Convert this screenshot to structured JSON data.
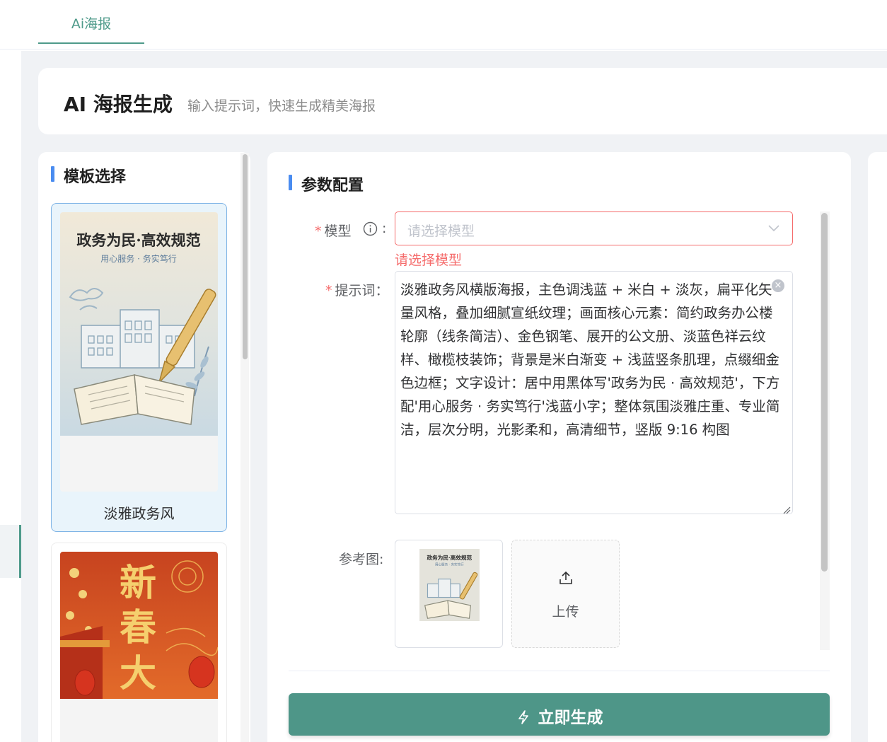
{
  "tabs": [
    {
      "label": "Ai海报"
    }
  ],
  "header": {
    "title": "AI 海报生成",
    "subtitle": "输入提示词，快速生成精美海报"
  },
  "templates": {
    "title": "模板选择",
    "items": [
      {
        "name": "淡雅政务风",
        "poster_title": "政务为民·高效规范",
        "poster_sub": "用心服务 · 务实笃行"
      },
      {
        "name": "",
        "poster_title": "新春大",
        "poster_sub": ""
      }
    ]
  },
  "params": {
    "title": "参数配置",
    "model_label": "模型",
    "model_placeholder": "请选择模型",
    "model_error": "请选择模型",
    "prompt_label": "提示词",
    "prompt_value": "淡雅政务风横版海报，主色调浅蓝 + 米白 + 淡灰，扁平化矢量风格，叠加细腻宣纸纹理；画面核心元素：简约政务办公楼轮廓（线条简洁）、金色钢笔、展开的公文册、淡蓝色祥云纹样、橄榄枝装饰；背景是米白渐变 + 浅蓝竖条肌理，点缀细金色边框；文字设计：居中用黑体写'政务为民 · 高效规范'，下方配'用心服务 · 务实笃行'浅蓝小字；整体氛围淡雅庄重、专业简洁，层次分明，光影柔和，高清细节，竖版 9:16 构图",
    "ref_label": "参考图",
    "upload_label": "上传",
    "generate_label": "立即生成",
    "colon": ":",
    "colon_cn": "："
  },
  "colors": {
    "accent": "#4e9a8a",
    "button": "#4e9688",
    "error": "#f56c6c",
    "section_bar": "#4a8cf0"
  }
}
